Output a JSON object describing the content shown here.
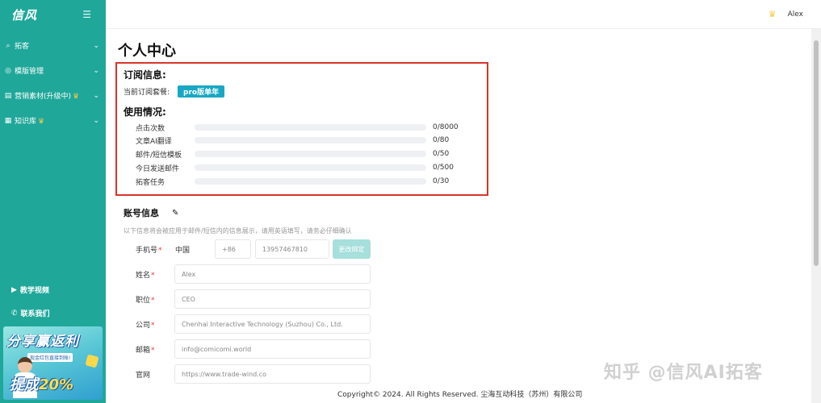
{
  "app": {
    "logo": "信风",
    "menu_icon": "menu-fold-icon"
  },
  "sidebar": {
    "items": [
      {
        "label": "拓客",
        "icon": "search-icon",
        "crown": false
      },
      {
        "label": "模版管理",
        "icon": "check-circle-icon",
        "crown": false
      },
      {
        "label": "营销素材(升级中)",
        "icon": "material-icon",
        "crown": true
      },
      {
        "label": "知识库",
        "icon": "book-icon",
        "crown": true
      }
    ],
    "tutorial": "教学视频",
    "contact": "联系我们",
    "promo": {
      "title": "分享赢返利",
      "subtitle": "现金红包直接到账!",
      "big_prefix": "提成",
      "big_num": "20%"
    }
  },
  "topbar": {
    "user_name": "Alex"
  },
  "page": {
    "title": "个人中心",
    "subscription": {
      "heading": "订阅信息:",
      "plan_label": "当前订阅套餐:",
      "plan_value": "pro版单年"
    },
    "usage": {
      "heading": "使用情况:",
      "rows": [
        {
          "label": "点击次数",
          "used": 0,
          "total": 8000,
          "text": "0/8000"
        },
        {
          "label": "文章AI翻译",
          "used": 0,
          "total": 80,
          "text": "0/80"
        },
        {
          "label": "邮件/短信模板",
          "used": 0,
          "total": 50,
          "text": "0/50"
        },
        {
          "label": "今日发送邮件",
          "used": 0,
          "total": 500,
          "text": "0/500"
        },
        {
          "label": "拓客任务",
          "used": 0,
          "total": 30,
          "text": "0/30"
        }
      ]
    },
    "account": {
      "heading": "账号信息",
      "hint": "以下信息将会被应用于邮件/短信内的信息展示，请用英语填写，请务必仔细确认",
      "phone_label": "手机号",
      "country": "中国",
      "dial_code": "+86",
      "phone": "13957467810",
      "change_button": "更改绑定",
      "name_label": "姓名",
      "name": "Alex",
      "position_label": "职位",
      "position": "CEO",
      "company_label": "公司",
      "company": "Chenhai Interactive Technology (Suzhou) Co., Ltd.",
      "email_label": "邮箱",
      "email": "info@comicomi.world",
      "website_label": "官网",
      "website": "https://www.trade-wind.co"
    }
  },
  "footer": "Copyright© 2024. All Rights Reserved. 尘海互动科技（苏州）有限公司",
  "watermark": "知乎 @信风AI拓客",
  "colors": {
    "sidebar": "#1fa79a",
    "badge": "#18a8c4",
    "highlight": "#d9342b",
    "crown": "#f7c948"
  }
}
